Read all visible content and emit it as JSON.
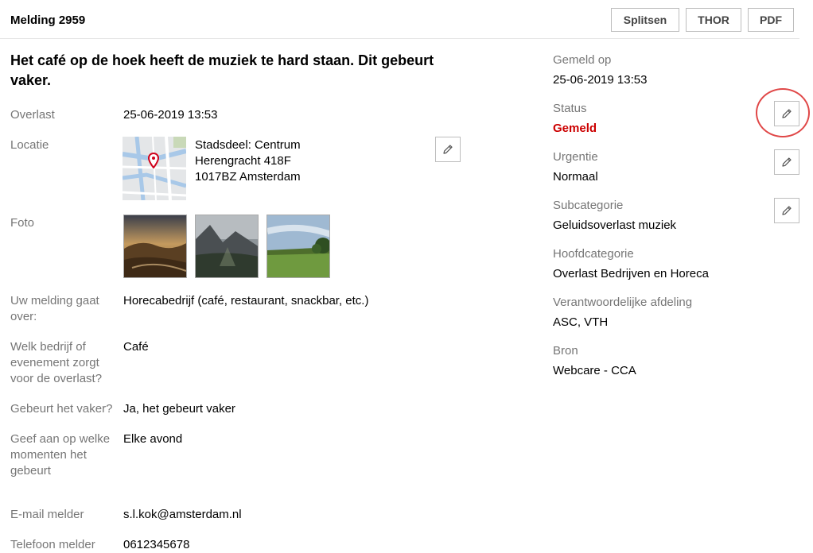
{
  "header": {
    "title": "Melding 2959",
    "buttons": {
      "split": "Splitsen",
      "thor": "THOR",
      "pdf": "PDF"
    }
  },
  "main": {
    "headline": "Het café op de hoek heeft de muziek te hard staan. Dit gebeurt vaker.",
    "fields": {
      "overlast": {
        "label": "Overlast",
        "value": "25-06-2019 13:53"
      },
      "locatie": {
        "label": "Locatie",
        "line1": "Stadsdeel: Centrum",
        "line2": "Herengracht 418F",
        "line3": "1017BZ Amsterdam"
      },
      "foto": {
        "label": "Foto"
      },
      "onderwerp": {
        "label": "Uw melding gaat over:",
        "value": "Horecabedrijf (café, restaurant, snackbar, etc.)"
      },
      "bedrijf": {
        "label": "Welk bedrijf of evenement zorgt voor de overlast?",
        "value": "Café"
      },
      "vaker": {
        "label": "Gebeurt het vaker?",
        "value": "Ja, het gebeurt vaker"
      },
      "momenten": {
        "label": "Geef aan op welke momenten het gebeurt",
        "value": "Elke avond"
      },
      "email": {
        "label": "E-mail melder",
        "value": "s.l.kok@amsterdam.nl"
      },
      "telefoon": {
        "label": "Telefoon melder",
        "value": "0612345678"
      }
    }
  },
  "sidebar": {
    "gemeld_op": {
      "label": "Gemeld op",
      "value": "25-06-2019 13:53"
    },
    "status": {
      "label": "Status",
      "value": "Gemeld"
    },
    "urgentie": {
      "label": "Urgentie",
      "value": "Normaal"
    },
    "subcategorie": {
      "label": "Subcategorie",
      "value": "Geluidsoverlast muziek"
    },
    "hoofdcategorie": {
      "label": "Hoofdcategorie",
      "value": "Overlast Bedrijven en Horeca"
    },
    "afdeling": {
      "label": "Verantwoordelijke afdeling",
      "value": "ASC, VTH"
    },
    "bron": {
      "label": "Bron",
      "value": "Webcare - CCA"
    }
  },
  "colors": {
    "status_red": "#cc0000",
    "label_grey": "#767676",
    "highlight": "#e04848"
  },
  "icons": {
    "edit": "pencil-icon",
    "map_marker": "map-pin-icon"
  }
}
